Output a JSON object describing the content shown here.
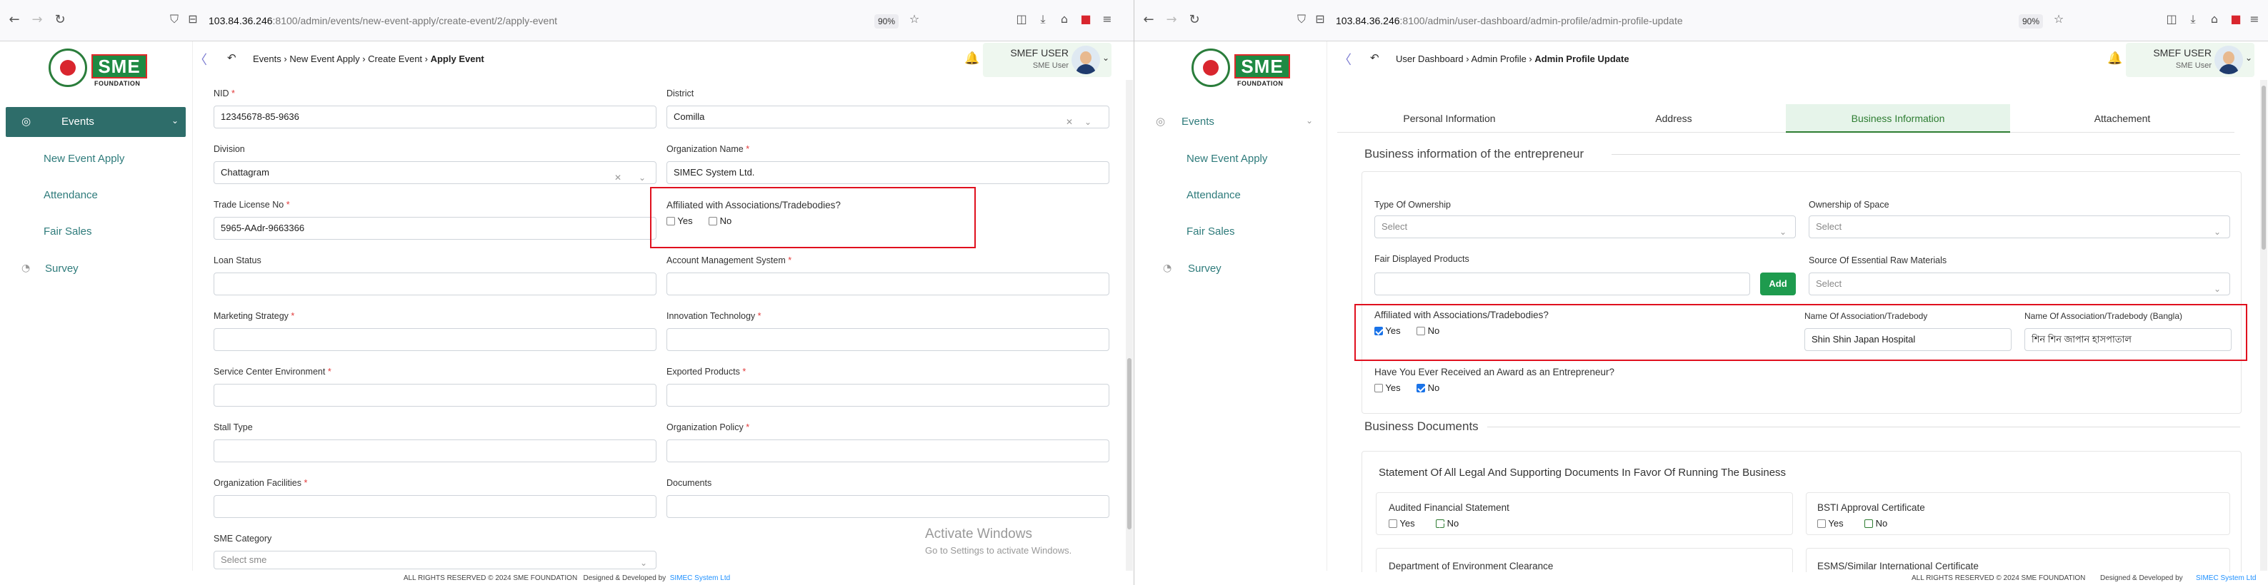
{
  "left": {
    "url_host": "103.84.36.246",
    "url_path": ":8100/admin/events/new-event-apply/create-event/2/apply-event",
    "zoom": "90%",
    "nav": {
      "events": "Events",
      "new_event_apply": "New Event Apply",
      "attendance": "Attendance",
      "fair_sales": "Fair Sales",
      "survey": "Survey"
    },
    "breadcrumb": [
      "Events",
      "New Event Apply",
      "Create Event",
      "Apply Event"
    ],
    "user": {
      "name": "SMEF USER",
      "role": "SME User"
    },
    "form": {
      "nid_label": "NID",
      "nid_value": "12345678-85-9636",
      "district_label": "District",
      "district_value": "Comilla",
      "division_label": "Division",
      "division_value": "Chattagram",
      "orgname_label": "Organization Name",
      "orgname_value": "SIMEC System Ltd.",
      "trade_label": "Trade License No",
      "trade_value": "5965-AAdr-9663366",
      "affiliated_label": "Affiliated with Associations/Tradebodies?",
      "yes": "Yes",
      "no": "No",
      "loan_label": "Loan Status",
      "account_label": "Account Management System",
      "marketing_label": "Marketing Strategy",
      "innovation_label": "Innovation Technology",
      "service_label": "Service Center Environment",
      "exported_label": "Exported Products",
      "stall_label": "Stall Type",
      "policy_label": "Organization Policy",
      "facilities_label": "Organization Facilities",
      "documents_label": "Documents",
      "category_label": "SME Category",
      "category_placeholder": "Select sme"
    },
    "watermark_title": "Activate Windows",
    "watermark_sub": "Go to Settings to activate Windows."
  },
  "right": {
    "url_host": "103.84.36.246",
    "url_path": ":8100/admin/user-dashboard/admin-profile/admin-profile-update",
    "zoom": "90%",
    "nav": {
      "events": "Events",
      "new_event_apply": "New Event Apply",
      "attendance": "Attendance",
      "fair_sales": "Fair Sales",
      "survey": "Survey"
    },
    "breadcrumb": [
      "User Dashboard",
      "Admin Profile",
      "Admin Profile Update"
    ],
    "user": {
      "name": "SMEF USER",
      "role": "SME User"
    },
    "tabs": [
      "Personal Information",
      "Address",
      "Business Information",
      "Attachement"
    ],
    "active_tab": "Business Information",
    "section_title": "Business information of the entrepreneur",
    "form": {
      "ownership_type_label": "Type Of Ownership",
      "ownership_type_value": "Select",
      "space_label": "Ownership of Space",
      "space_value": "Select",
      "fair_products_label": "Fair Displayed Products",
      "add_button": "Add",
      "raw_label": "Source Of Essential Raw Materials",
      "raw_value": "Select",
      "affiliated_label": "Affiliated with Associations/Tradebodies?",
      "yes": "Yes",
      "no": "No",
      "assoc_label": "Name Of Association/Tradebody",
      "assoc_value": "Shin Shin Japan Hospital",
      "assoc_bn_label": "Name Of Association/Tradebody (Bangla)",
      "assoc_bn_value": "শিন শিন জাপান হাসপাতাল",
      "award_label": "Have You Ever Received an Award as an Entrepreneur?"
    },
    "docs_title": "Business Documents",
    "docs_card_title": "Statement Of All Legal And Supporting Documents In Favor Of Running The Business",
    "docs": {
      "audited": "Audited Financial Statement",
      "bsti": "BSTI Approval Certificate",
      "env": "Department of Environment Clearance",
      "esms": "ESMS/Similar International Certificate"
    }
  },
  "footer": {
    "text": "ALL RIGHTS RESERVED © 2024 SME FOUNDATION",
    "designed": "Designed & Developed by",
    "link": "SIMEC System Ltd"
  }
}
